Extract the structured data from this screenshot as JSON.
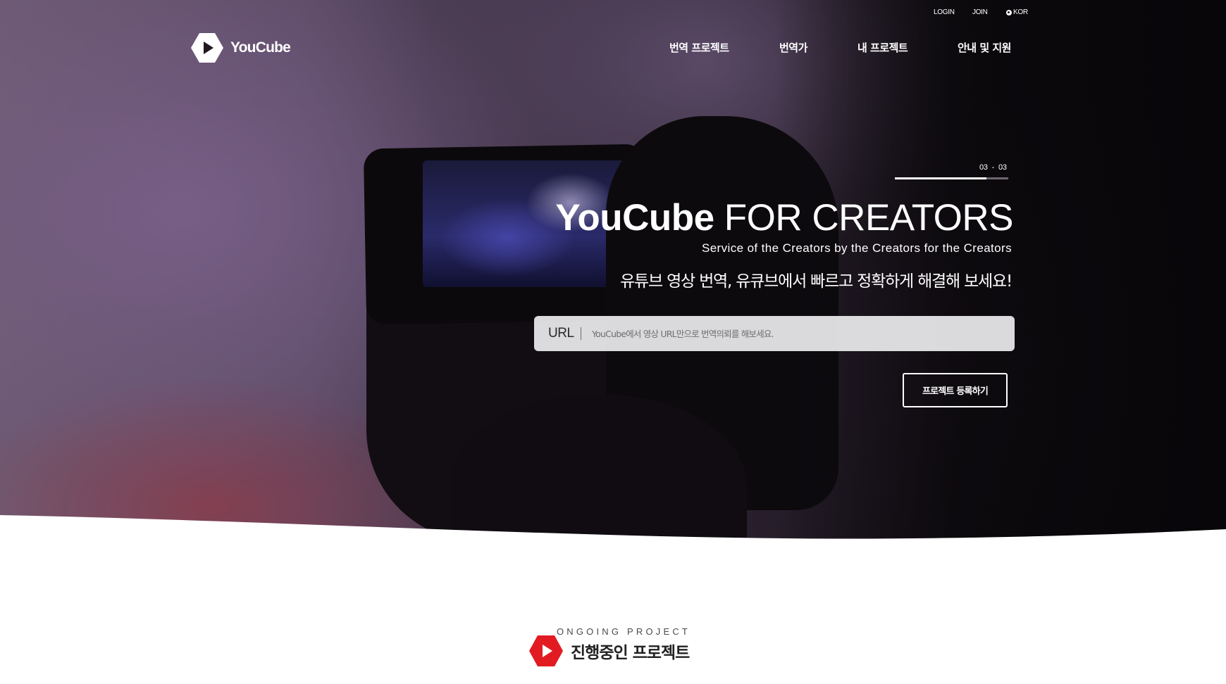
{
  "top_util": {
    "login": "LOGIN",
    "join": "JOIN",
    "language": "KOR"
  },
  "logo": {
    "text": "YouCube",
    "icon": "play-hexagon-icon"
  },
  "nav": {
    "items": [
      {
        "label": "번역 프로젝트"
      },
      {
        "label": "번역가"
      },
      {
        "label": "내 프로젝트"
      },
      {
        "label": "안내 및 지원"
      }
    ]
  },
  "slider": {
    "current": "03",
    "separator": "-",
    "total": "03",
    "progress_fraction": 0.81
  },
  "hero": {
    "title_strong": "YouCube",
    "title_rest": " FOR CREATORS",
    "subtitle": "Service of the Creators by the Creators for the Creators",
    "korean_tagline": "유튜브 영상 번역, 유큐브에서 빠르고 정확하게 해결해 보세요!"
  },
  "url_field": {
    "label": "URL",
    "value": "",
    "placeholder": "YouCube에서 영상 URL만으로 번역의뢰를 해보세요."
  },
  "register_button": {
    "label": "프로젝트 등록하기"
  },
  "ongoing": {
    "eyebrow": "ONGOING PROJECT",
    "title": "진행중인 프로젝트",
    "icon": "play-hexagon-icon"
  },
  "colors": {
    "brand_red": "#e21b23",
    "white": "#ffffff",
    "hero_dark": "#0a080b"
  }
}
